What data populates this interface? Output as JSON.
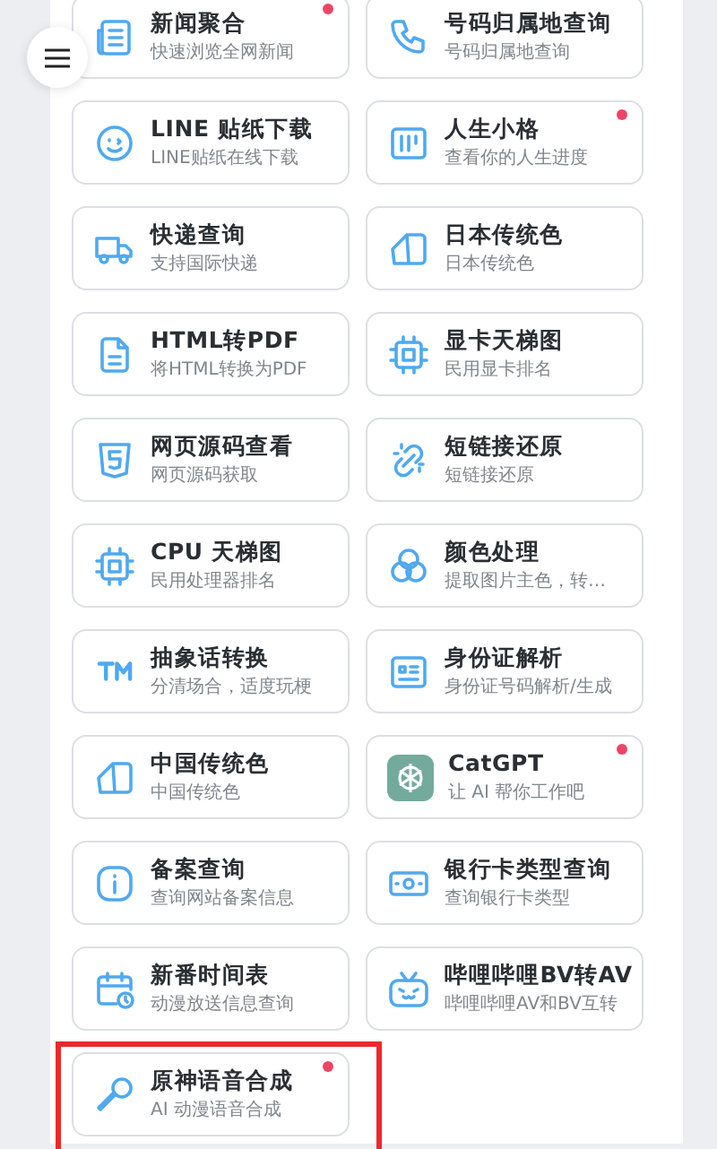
{
  "tools": [
    {
      "title": "新闻聚合",
      "subtitle": "快速浏览全网新闻",
      "new": true,
      "highlighted": false
    },
    {
      "title": "号码归属地查询",
      "subtitle": "号码归属地查询",
      "new": false,
      "highlighted": false
    },
    {
      "title": "LINE 贴纸下载",
      "subtitle": "LINE贴纸在线下载",
      "new": false,
      "highlighted": false
    },
    {
      "title": "人生小格",
      "subtitle": "查看你的人生进度",
      "new": true,
      "highlighted": false
    },
    {
      "title": "快递查询",
      "subtitle": "支持国际快递",
      "new": false,
      "highlighted": false
    },
    {
      "title": "日本传统色",
      "subtitle": "日本传统色",
      "new": false,
      "highlighted": false
    },
    {
      "title": "HTML转PDF",
      "subtitle": "将HTML转换为PDF",
      "new": false,
      "highlighted": false
    },
    {
      "title": "显卡天梯图",
      "subtitle": "民用显卡排名",
      "new": false,
      "highlighted": false
    },
    {
      "title": "网页源码查看",
      "subtitle": "网页源码获取",
      "new": false,
      "highlighted": false
    },
    {
      "title": "短链接还原",
      "subtitle": "短链接还原",
      "new": false,
      "highlighted": false
    },
    {
      "title": "CPU 天梯图",
      "subtitle": "民用处理器排名",
      "new": false,
      "highlighted": false
    },
    {
      "title": "颜色处理",
      "subtitle": "提取图片主色，转…",
      "new": false,
      "highlighted": false
    },
    {
      "title": "抽象话转换",
      "subtitle": "分清场合，适度玩梗",
      "new": false,
      "highlighted": false
    },
    {
      "title": "身份证解析",
      "subtitle": "身份证号码解析/生成",
      "new": false,
      "highlighted": false
    },
    {
      "title": "中国传统色",
      "subtitle": "中国传统色",
      "new": false,
      "highlighted": false
    },
    {
      "title": "CatGPT",
      "subtitle": "让 AI 帮你工作吧",
      "new": true,
      "highlighted": false
    },
    {
      "title": "备案查询",
      "subtitle": "查询网站备案信息",
      "new": false,
      "highlighted": false
    },
    {
      "title": "银行卡类型查询",
      "subtitle": "查询银行卡类型",
      "new": false,
      "highlighted": false
    },
    {
      "title": "新番时间表",
      "subtitle": "动漫放送信息查询",
      "new": false,
      "highlighted": false
    },
    {
      "title": "哔哩哔哩BV转AV",
      "subtitle": "哔哩哔哩AV和BV互转",
      "new": false,
      "highlighted": false
    },
    {
      "title": "原神语音合成",
      "subtitle": "AI 动漫语音合成",
      "new": true,
      "highlighted": true
    }
  ]
}
